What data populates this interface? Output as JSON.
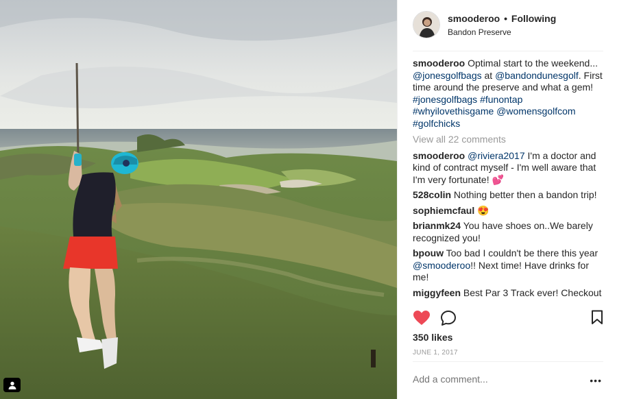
{
  "header": {
    "username": "smooderoo",
    "separator": "•",
    "follow_status": "Following",
    "location": "Bandon Preserve"
  },
  "caption": {
    "user": "smooderoo",
    "t1": "Optimal start to the weekend...",
    "m1": "@jonesgolfbags",
    "t2": "at",
    "m2": "@bandondunesgolf",
    "t3": ". First time around the preserve and what a gem!",
    "h1": "#jonesgolfbags",
    "h2": "#funontap",
    "h3": "#whyilovethisgame",
    "m3": "@womensgolfcom",
    "h4": "#golfchicks"
  },
  "view_all": "View all 22 comments",
  "comments": [
    {
      "user": "smooderoo",
      "mention": "@riviera2017",
      "text": "I'm a doctor and kind of contract myself - I'm well aware that I'm very fortunate!",
      "emoji": "💕"
    },
    {
      "user": "528colin",
      "text": "Nothing better then a bandon trip!"
    },
    {
      "user": "sophiemcfaul",
      "emoji": "😍"
    },
    {
      "user": "brianmk24",
      "text": "You have shoes on..We barely recognized you!"
    },
    {
      "user": "bpouw",
      "text": "Too bad I couldn't be there this year",
      "mention": "@smooderoo",
      "text2": "!! Next time! Have drinks for me!"
    },
    {
      "user": "miggyfeen",
      "text": "Best Par 3 Track ever! Checkout"
    }
  ],
  "likes": "350 likes",
  "date": "JUNE 1, 2017",
  "add_comment_placeholder": "Add a comment...",
  "more_label": "•••",
  "icons": {
    "like": "heart-icon",
    "comment": "comment-bubble-icon",
    "save": "bookmark-icon",
    "user_tag": "person-icon",
    "more": "more-options-icon"
  },
  "colors": {
    "heart": "#ed4956",
    "link": "#003569",
    "muted": "#999999"
  }
}
